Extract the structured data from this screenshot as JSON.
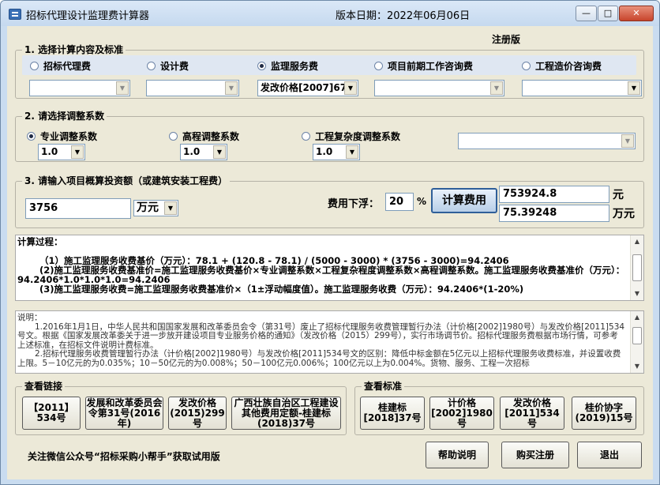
{
  "window": {
    "title": "招标代理设计监理费计算器",
    "version_date": "版本日期：2022年06月06日",
    "registered": "注册版",
    "min_icon": "minimize-icon",
    "max_icon": "maximize-icon",
    "close_icon": "close-icon"
  },
  "section1": {
    "title": "1. 选择计算内容及标准",
    "options": [
      {
        "label": "招标代理费",
        "selected": false,
        "dropdown": ""
      },
      {
        "label": "设计费",
        "selected": false,
        "dropdown": ""
      },
      {
        "label": "监理服务费",
        "selected": true,
        "dropdown": "发改价格[2007]67"
      },
      {
        "label": "项目前期工作咨询费",
        "selected": false,
        "dropdown": ""
      },
      {
        "label": "工程造价咨询费",
        "selected": false,
        "dropdown": ""
      }
    ]
  },
  "section2": {
    "title": "2. 请选择调整系数",
    "options": [
      {
        "label": "专业调整系数",
        "selected": true,
        "value": "1.0"
      },
      {
        "label": "高程调整系数",
        "selected": false,
        "value": "1.0"
      },
      {
        "label": "工程复杂度调整系数",
        "selected": false,
        "value": "1.0"
      }
    ],
    "extra_dropdown": ""
  },
  "section3": {
    "title": "3. 请输入项目概算投资额（或建筑安装工程费）",
    "amount": "3756",
    "unit": "万元",
    "discount_label": "费用下浮：",
    "discount_value": "20",
    "percent": "%",
    "calc_button": "计算费用",
    "result_yuan": "753924.8",
    "result_yuan_unit": "元",
    "result_wan": "75.39248",
    "result_wan_unit": "万元"
  },
  "calc_process": {
    "heading": "计算过程：",
    "lines": [
      "（1）施工监理服务收费基价（万元）：78.1 + (120.8 - 78.1) / (5000 - 3000) * (3756 - 3000)=94.2406",
      "(2)施工监理服务收费基准价=施工监理服务收费基价×专业调整系数×工程复杂程度调整系数×高程调整系数。施工监理服务收费基准价（万元）：94.2406*1.0*1.0*1.0=94.2406",
      "(3)施工监理服务收费=施工监理服务收费基准价×（1±浮动幅度值）。施工监理服务收费（万元）：94.2406*(1-20%)"
    ]
  },
  "notes": {
    "heading": "说明：",
    "lines": [
      "1.2016年1月1日，中华人民共和国国家发展和改革委员会令（第31号）废止了招标代理服务收费管理暂行办法（计价格[2002]1980号）与发改价格[2011]534号文。根据《国家发展改革委关于进一步放开建设项目专业服务价格的通知》（发改价格（2015）299号），实行市场调节价。招标代理服务费根据市场行情，可参考上述标准，在招标文件说明计费标准。",
      "2.招标代理服务收费管理暂行办法（计价格[2002]1980号）与发改价格[2011]534号文的区别：降低中标金额在5亿元以上招标代理服务收费标准，并设置收费上限。5－10亿元的为0.035%；10－50亿元的为0.008%；50－100亿元0.006%；100亿元以上为0.004%。货物、服务、工程一次招标"
    ]
  },
  "links": {
    "title": "查看链接",
    "buttons": [
      "【2011】534号",
      "发展和改革委员会令第31号(2016年)",
      "发改价格(2015)299号",
      "广西壮族自治区工程建设其他费用定额-桂建标(2018)37号"
    ]
  },
  "standards": {
    "title": "查看标准",
    "buttons": [
      "桂建标[2018]37号",
      "计价格[2002]1980号",
      "发改价格[2011]534号",
      "桂价协字(2019)15号"
    ]
  },
  "footer": {
    "note": "关注微信公众号“招标采购小帮手”获取试用版",
    "help": "帮助说明",
    "buy": "购买注册",
    "exit": "退出"
  }
}
